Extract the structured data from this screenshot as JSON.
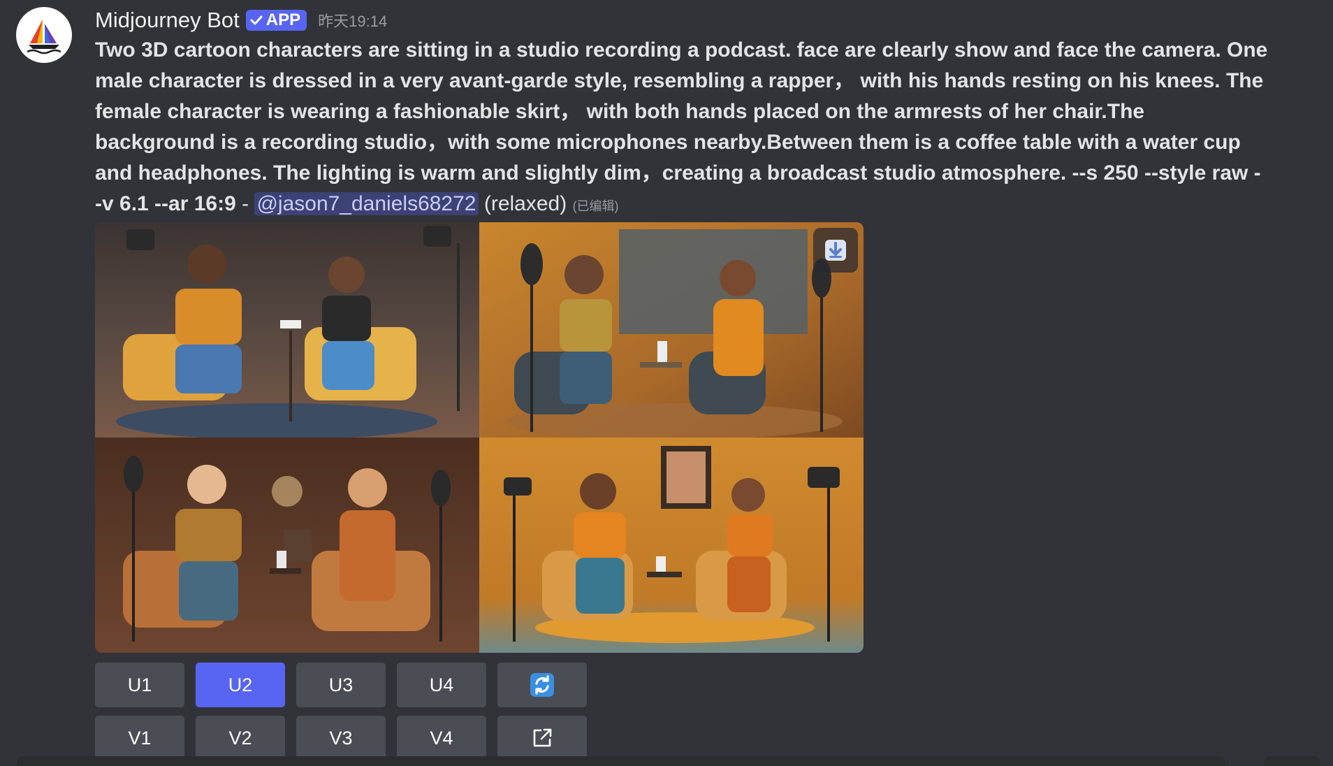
{
  "author": {
    "name": "Midjourney Bot",
    "badge": "APP",
    "timestamp": "昨天19:14",
    "avatar_icon": "sailboat-icon"
  },
  "message": {
    "prompt_lines": [
      "Two 3D cartoon characters are sitting in a studio recording a podcast. face are clearly show and face the camera. One",
      "male character is dressed in a very avant-garde style, resembling a rapper， with his hands resting on his knees. The",
      "female character is wearing a fashionable skirt， with both hands placed on the armrests of her chair.The",
      "background is a recording studio，with some microphones nearby.Between them is a coffee table with a water cup",
      "and headphones. The lighting is warm and slightly dim，creating a broadcast studio atmosphere. --s 250 --style raw -"
    ],
    "last_line_prefix": "-v 6.1 --ar 16:9",
    "dash": " - ",
    "mention": "@jason7_daniels68272",
    "status": "(relaxed)",
    "edited": "(已编辑)"
  },
  "images": {
    "panels": [
      "image-1",
      "image-2",
      "image-3",
      "image-4"
    ],
    "download_icon": "download-icon"
  },
  "buttons": {
    "row1": [
      {
        "label": "U1",
        "active": false
      },
      {
        "label": "U2",
        "active": true
      },
      {
        "label": "U3",
        "active": false
      },
      {
        "label": "U4",
        "active": false
      },
      {
        "icon": "reroll-icon",
        "active": false
      }
    ],
    "row2": [
      {
        "label": "V1",
        "active": false
      },
      {
        "label": "V2",
        "active": false
      },
      {
        "label": "V3",
        "active": false
      },
      {
        "label": "V4",
        "active": false
      },
      {
        "icon": "external-link-icon",
        "active": false
      }
    ]
  },
  "colors": {
    "background": "#323339",
    "accent": "#5865f2",
    "button": "#4b4d55"
  }
}
